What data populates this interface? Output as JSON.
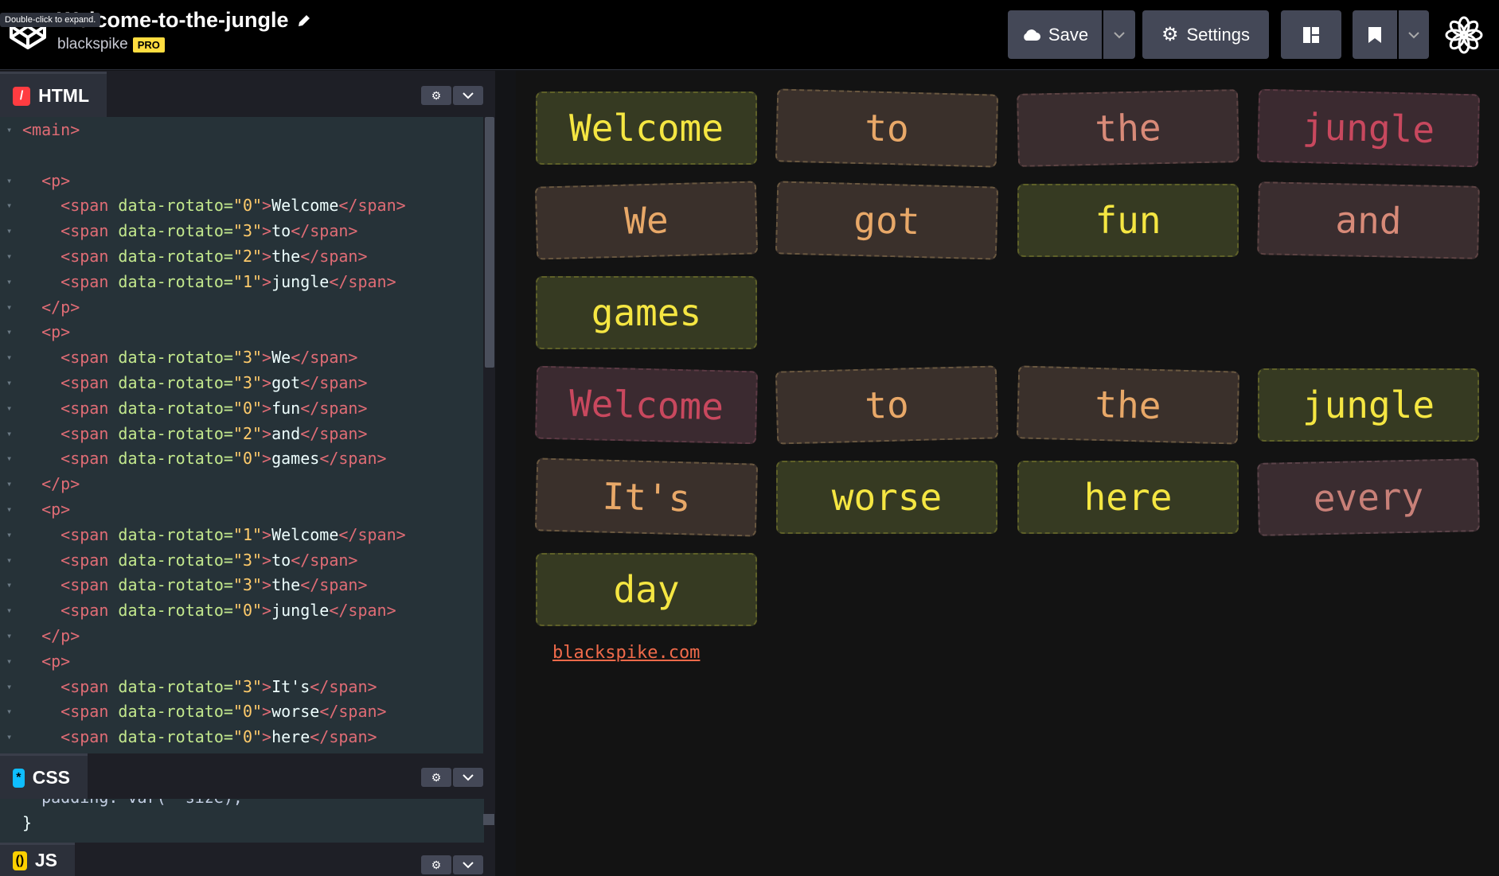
{
  "header": {
    "tooltip": "Double-click to expand.",
    "pen_title": "Welcome-to-the-jungle",
    "user": "blackspike",
    "badge": "PRO",
    "save_label": "Save",
    "settings_label": "Settings"
  },
  "panes": {
    "html_label": "HTML",
    "css_label": "CSS",
    "js_label": "JS",
    "css_snippet_1": "  padding: var(--size);",
    "css_snippet_2": "}"
  },
  "html_code": [
    {
      "indent": "",
      "open": "<main>",
      "attr": "",
      "val": "",
      "mid": "",
      "text": "",
      "close": ""
    },
    {
      "indent": "",
      "open": "",
      "attr": "",
      "val": "",
      "mid": "",
      "text": "",
      "close": ""
    },
    {
      "indent": "  ",
      "open": "<p>",
      "attr": "",
      "val": "",
      "mid": "",
      "text": "",
      "close": ""
    },
    {
      "indent": "    ",
      "open": "<span ",
      "attr": "data-rotato=",
      "val": "\"0\"",
      "mid": ">",
      "text": "Welcome",
      "close": "</span>"
    },
    {
      "indent": "    ",
      "open": "<span ",
      "attr": "data-rotato=",
      "val": "\"3\"",
      "mid": ">",
      "text": "to",
      "close": "</span>"
    },
    {
      "indent": "    ",
      "open": "<span ",
      "attr": "data-rotato=",
      "val": "\"2\"",
      "mid": ">",
      "text": "the",
      "close": "</span>"
    },
    {
      "indent": "    ",
      "open": "<span ",
      "attr": "data-rotato=",
      "val": "\"1\"",
      "mid": ">",
      "text": "jungle",
      "close": "</span>"
    },
    {
      "indent": "  ",
      "open": "</p>",
      "attr": "",
      "val": "",
      "mid": "",
      "text": "",
      "close": ""
    },
    {
      "indent": "  ",
      "open": "<p>",
      "attr": "",
      "val": "",
      "mid": "",
      "text": "",
      "close": ""
    },
    {
      "indent": "    ",
      "open": "<span ",
      "attr": "data-rotato=",
      "val": "\"3\"",
      "mid": ">",
      "text": "We",
      "close": "</span>"
    },
    {
      "indent": "    ",
      "open": "<span ",
      "attr": "data-rotato=",
      "val": "\"3\"",
      "mid": ">",
      "text": "got",
      "close": "</span>"
    },
    {
      "indent": "    ",
      "open": "<span ",
      "attr": "data-rotato=",
      "val": "\"0\"",
      "mid": ">",
      "text": "fun",
      "close": "</span>"
    },
    {
      "indent": "    ",
      "open": "<span ",
      "attr": "data-rotato=",
      "val": "\"2\"",
      "mid": ">",
      "text": "and",
      "close": "</span>"
    },
    {
      "indent": "    ",
      "open": "<span ",
      "attr": "data-rotato=",
      "val": "\"0\"",
      "mid": ">",
      "text": "games",
      "close": "</span>"
    },
    {
      "indent": "  ",
      "open": "</p>",
      "attr": "",
      "val": "",
      "mid": "",
      "text": "",
      "close": ""
    },
    {
      "indent": "  ",
      "open": "<p>",
      "attr": "",
      "val": "",
      "mid": "",
      "text": "",
      "close": ""
    },
    {
      "indent": "    ",
      "open": "<span ",
      "attr": "data-rotato=",
      "val": "\"1\"",
      "mid": ">",
      "text": "Welcome",
      "close": "</span>"
    },
    {
      "indent": "    ",
      "open": "<span ",
      "attr": "data-rotato=",
      "val": "\"3\"",
      "mid": ">",
      "text": "to",
      "close": "</span>"
    },
    {
      "indent": "    ",
      "open": "<span ",
      "attr": "data-rotato=",
      "val": "\"3\"",
      "mid": ">",
      "text": "the",
      "close": "</span>"
    },
    {
      "indent": "    ",
      "open": "<span ",
      "attr": "data-rotato=",
      "val": "\"0\"",
      "mid": ">",
      "text": "jungle",
      "close": "</span>"
    },
    {
      "indent": "  ",
      "open": "</p>",
      "attr": "",
      "val": "",
      "mid": "",
      "text": "",
      "close": ""
    },
    {
      "indent": "  ",
      "open": "<p>",
      "attr": "",
      "val": "",
      "mid": "",
      "text": "",
      "close": ""
    },
    {
      "indent": "    ",
      "open": "<span ",
      "attr": "data-rotato=",
      "val": "\"3\"",
      "mid": ">",
      "text": "It's",
      "close": "</span>"
    },
    {
      "indent": "    ",
      "open": "<span ",
      "attr": "data-rotato=",
      "val": "\"0\"",
      "mid": ">",
      "text": "worse",
      "close": "</span>"
    },
    {
      "indent": "    ",
      "open": "<span ",
      "attr": "data-rotato=",
      "val": "\"0\"",
      "mid": ">",
      "text": "here",
      "close": "</span>"
    }
  ],
  "preview_words": [
    {
      "text": "Welcome",
      "rotato": 0,
      "color": "yellow"
    },
    {
      "text": "to",
      "rotato": 3,
      "color": "orange"
    },
    {
      "text": "the",
      "rotato": 2,
      "color": "rose"
    },
    {
      "text": "jungle",
      "rotato": 1,
      "color": "red"
    },
    {
      "text": "We",
      "rotato": 3,
      "color": "orange"
    },
    {
      "text": "got",
      "rotato": 3,
      "color": "orange"
    },
    {
      "text": "fun",
      "rotato": 0,
      "color": "yellow"
    },
    {
      "text": "and",
      "rotato": 2,
      "color": "rose"
    },
    {
      "text": "games",
      "rotato": 0,
      "color": "yellow"
    },
    {
      "text": "Welcome",
      "rotato": 1,
      "color": "red"
    },
    {
      "text": "to",
      "rotato": 3,
      "color": "orange"
    },
    {
      "text": "the",
      "rotato": 3,
      "color": "orange"
    },
    {
      "text": "jungle",
      "rotato": 0,
      "color": "yellow"
    },
    {
      "text": "It's",
      "rotato": 3,
      "color": "orange"
    },
    {
      "text": "worse",
      "rotato": 0,
      "color": "yellow"
    },
    {
      "text": "here",
      "rotato": 0,
      "color": "yellow"
    },
    {
      "text": "every",
      "rotato": 2,
      "color": "pink"
    },
    {
      "text": "day",
      "rotato": 0,
      "color": "yellow"
    }
  ],
  "footer_link": "blackspike.com",
  "colors": {
    "header_bg": "#000000",
    "button_bg": "#444857",
    "code_bg": "#263238",
    "preview_bg": "#131313",
    "link": "#f06a4a",
    "badge": "#ffdd40"
  }
}
